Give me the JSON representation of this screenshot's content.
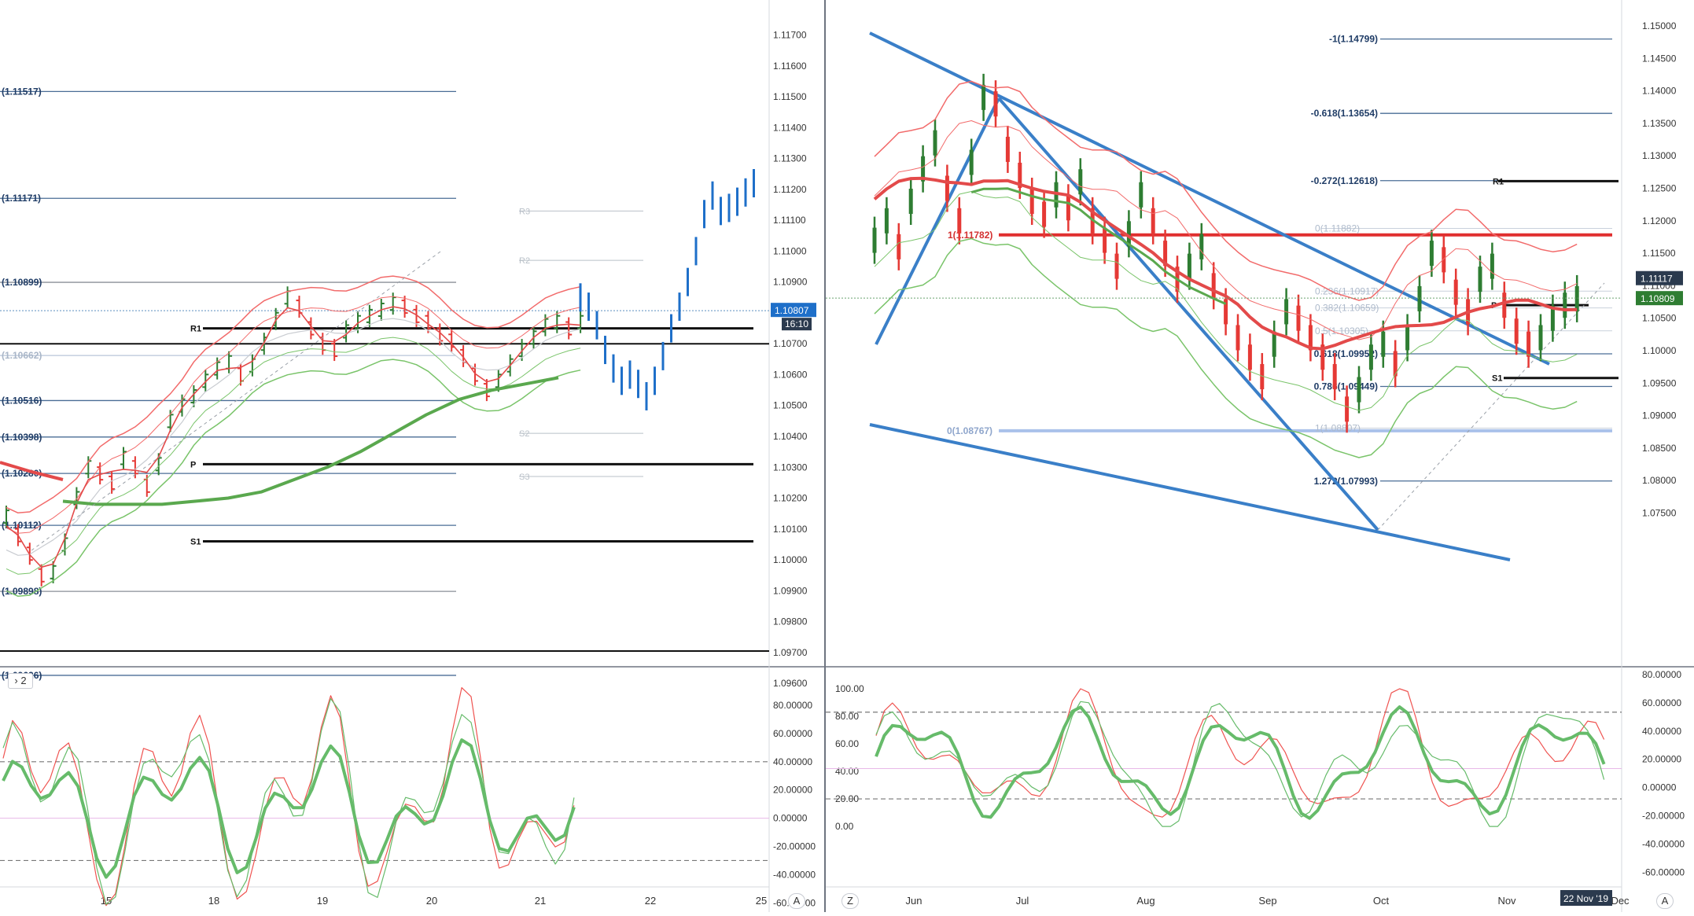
{
  "colors": {
    "axis_text": "#333333",
    "price_bar_up": "#2e7d32",
    "price_bar_down": "#e53935",
    "bollinger": "#f26b6b",
    "bollinger_lower": "#7ac46a",
    "ma_red": "#e34a4a",
    "ma_green": "#5aa84e",
    "trendline": "#3a7fc8",
    "fib_line": "#4a6d96",
    "pivot_grey": "#b9c0c8",
    "level_black": "#111111",
    "projection_blue": "#1e6fc9",
    "osc_green": "#66bb6a",
    "osc_red": "#ef5350",
    "badge_blue": "#1e6fc9",
    "badge_green": "#2e7d32",
    "badge_dark": "#2b3a4e"
  },
  "left_panel": {
    "price_axis_ticks": [
      "1.11700",
      "1.11600",
      "1.11500",
      "1.11400",
      "1.11300",
      "1.11200",
      "1.11100",
      "1.11000",
      "1.10900",
      "1.10700",
      "1.10600",
      "1.10500",
      "1.10400",
      "1.10300",
      "1.10200",
      "1.10100",
      "1.10000",
      "1.09900",
      "1.09800",
      "1.09700",
      "1.09600"
    ],
    "price_badge": "1.10807",
    "time_badge": "16:10",
    "level_labels": [
      "(1.11517)",
      "(1.11171)",
      "(1.10899)",
      "(1.10662)",
      "(1.10516)",
      "(1.10398)",
      "(1.10280)",
      "(1.10112)",
      "(1.09898)",
      "(1.09626)"
    ],
    "pivot_labels": {
      "R1": "R1",
      "P": "P",
      "S1": "S1",
      "R3": "R3",
      "R2": "R2",
      "S2": "S2",
      "S3": "S3"
    },
    "date_labels": [
      "15",
      "18",
      "19",
      "20",
      "21",
      "22",
      "25"
    ],
    "osc_ticks": [
      "80.00000",
      "60.00000",
      "40.00000",
      "20.00000",
      "0.00000",
      "-20.00000",
      "-40.00000",
      "-60.00000"
    ],
    "interval_button": "2",
    "auto_button": "A"
  },
  "right_panel": {
    "price_axis_ticks": [
      "1.15000",
      "1.14500",
      "1.14000",
      "1.13500",
      "1.13000",
      "1.12500",
      "1.12000",
      "1.11500",
      "1.11000",
      "1.10500",
      "1.10000",
      "1.09500",
      "1.09000",
      "1.08500",
      "1.08000",
      "1.07500"
    ],
    "price_badge_1": "1.11117",
    "price_badge_2": "1.10809",
    "fib_labels": [
      "-1(1.14799)",
      "-0.618(1.13654)",
      "-0.272(1.12618)",
      "1(1.11782)",
      "0.618(1.09952)",
      "0.786(1.09449)",
      "1.272(1.07993)",
      "0(1.08767)"
    ],
    "fib_faint_labels": [
      "0(1.11882)",
      "0.236(1.10917)",
      "0.382(1.10659)",
      "0.5(1.10305)",
      "1(1.08807)"
    ],
    "pivot_labels": {
      "R1": "R1",
      "P": "P",
      "S1": "S1"
    },
    "date_labels": [
      "Jun",
      "Jul",
      "Aug",
      "Sep",
      "Oct",
      "Nov",
      "Dec"
    ],
    "date_badge": "22 Nov '19",
    "osc_ticks_left": [
      "100.00",
      "80.00",
      "60.00",
      "40.00",
      "20.00",
      "0.00"
    ],
    "osc_ticks_right": [
      "80.00000",
      "60.00000",
      "40.00000",
      "20.00000",
      "0.00000",
      "-20.00000",
      "-40.00000",
      "-60.00000"
    ],
    "z_button": "Z",
    "auto_button": "A"
  },
  "chart_data": [
    {
      "type": "line",
      "panel": "left",
      "description_free": true,
      "x_dates": [
        "15",
        "18",
        "19",
        "20",
        "21",
        "22",
        "25"
      ],
      "ylim": [
        1.0955,
        1.1175
      ],
      "series": [
        {
          "name": "",
          "kind": "price_bars",
          "values": [
            1.1014,
            1.1008,
            1.1002,
            1.0995,
            1.0996,
            1.1005,
            1.102,
            1.103,
            1.1028,
            1.1025,
            1.1033,
            1.103,
            1.1024,
            1.1031,
            1.1045,
            1.105,
            1.1053,
            1.1058,
            1.1062,
            1.1064,
            1.106,
            1.1063,
            1.107,
            1.1078,
            1.1085,
            1.1082,
            1.1075,
            1.107,
            1.1068,
            1.1074,
            1.1077,
            1.1079,
            1.1081,
            1.1083,
            1.1082,
            1.1079,
            1.1077,
            1.1073,
            1.1071,
            1.1066,
            1.106,
            1.1055,
            1.1058,
            1.1063,
            1.1068,
            1.1072,
            1.1076,
            1.1077,
            1.1075,
            1.1077
          ]
        },
        {
          "name": "",
          "kind": "projection",
          "values": [
            1.1085,
            1.1082,
            1.1076,
            1.1068,
            1.1062,
            1.1058,
            1.106,
            1.1057,
            1.1053,
            1.1058,
            1.1066,
            1.1075,
            1.1082,
            1.109,
            1.11,
            1.1112,
            1.1118,
            1.1113,
            1.1114,
            1.1116,
            1.1119,
            1.1122
          ]
        },
        {
          "name": "",
          "kind": "ma_green_thick",
          "values": [
            1.1019,
            1.1018,
            1.1018,
            1.1018,
            1.1019,
            1.102,
            1.1022,
            1.1026,
            1.103,
            1.1035,
            1.1041,
            1.1047,
            1.1052,
            1.1055,
            1.1057,
            1.1059
          ]
        }
      ],
      "horizontal_levels": [
        1.11517,
        1.11171,
        1.10899,
        1.10662,
        1.10516,
        1.10398,
        1.1028,
        1.10112,
        1.09898,
        1.09626
      ],
      "pivots": {
        "R1": 1.1075,
        "P": 1.1031,
        "S1": 1.1006,
        "R3": 1.1113,
        "R2": 1.1097,
        "S2": 1.1041,
        "S3": 1.1027
      }
    },
    {
      "type": "line",
      "panel": "right",
      "x_dates": [
        "Jun",
        "Jul",
        "Aug",
        "Sep",
        "Oct",
        "Nov",
        "Dec"
      ],
      "ylim": [
        1.0725,
        1.152
      ],
      "series": [
        {
          "name": "",
          "kind": "price_bars",
          "values": [
            1.117,
            1.12,
            1.116,
            1.123,
            1.128,
            1.132,
            1.125,
            1.12,
            1.129,
            1.139,
            1.138,
            1.131,
            1.127,
            1.123,
            1.121,
            1.124,
            1.122,
            1.126,
            1.12,
            1.117,
            1.113,
            1.118,
            1.124,
            1.12,
            1.115,
            1.111,
            1.113,
            1.116,
            1.11,
            1.106,
            1.102,
            1.099,
            1.096,
            1.101,
            1.106,
            1.105,
            1.102,
            1.099,
            1.096,
            1.091,
            1.094,
            1.099,
            1.101,
            1.098,
            1.102,
            1.108,
            1.115,
            1.114,
            1.109,
            1.106,
            1.111,
            1.113,
            1.107,
            1.103,
            1.101,
            1.102,
            1.105,
            1.107,
            1.108
          ]
        }
      ],
      "fib_levels": [
        1.14799,
        1.13654,
        1.12618,
        1.11782,
        1.09952,
        1.09449,
        1.07993,
        1.08767
      ],
      "pivots": {
        "R1": 1.1261,
        "P": 1.107,
        "S1": 1.0958
      }
    }
  ]
}
